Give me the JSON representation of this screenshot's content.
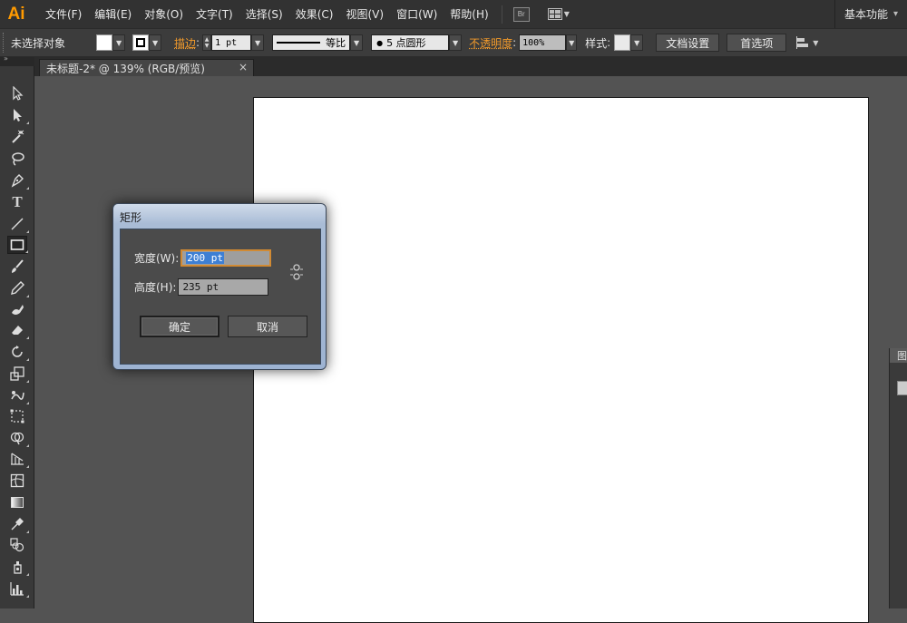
{
  "app": {
    "logo": "Ai",
    "accent": "#ff9a00"
  },
  "menu": {
    "items": [
      "文件(F)",
      "编辑(E)",
      "对象(O)",
      "文字(T)",
      "选择(S)",
      "效果(C)",
      "视图(V)",
      "窗口(W)",
      "帮助(H)"
    ],
    "bridge_label": "Br",
    "workspace": "基本功能",
    "workspace_arrow": "▾"
  },
  "control": {
    "selection_status": "未选择对象",
    "stroke_label": "描边",
    "stroke_weight": "1 pt",
    "stroke_profile": "等比",
    "brush": "5 点圆形",
    "brush_dot": "●",
    "opacity_label": "不透明度",
    "opacity_value": "100%",
    "style_label": "样式",
    "doc_setup": "文档设置",
    "preferences": "首选项",
    "colon": ":"
  },
  "tabs": [
    {
      "label": "未标题-2* @ 139% (RGB/预览)",
      "close": "×"
    }
  ],
  "tools": [
    "selection-tool",
    "direct-selection-tool",
    "magic-wand-tool",
    "lasso-tool",
    "pen-tool",
    "type-tool",
    "line-segment-tool",
    "rectangle-tool",
    "paintbrush-tool",
    "pencil-tool",
    "blob-brush-tool",
    "eraser-tool",
    "rotate-tool",
    "scale-tool",
    "warp-tool",
    "free-transform-tool",
    "shape-builder-tool",
    "perspective-grid-tool",
    "mesh-tool",
    "gradient-tool",
    "eyedropper-tool",
    "blend-tool",
    "symbol-sprayer-tool",
    "column-graph-tool"
  ],
  "type_tool_glyph": "T",
  "right_panel": {
    "label": "图"
  },
  "dialog": {
    "title": "矩形",
    "width_label": "宽度(W):",
    "width_value": "200 pt",
    "height_label": "高度(H):",
    "height_value": "235 pt",
    "ok_label": "确定",
    "cancel_label": "取消"
  }
}
